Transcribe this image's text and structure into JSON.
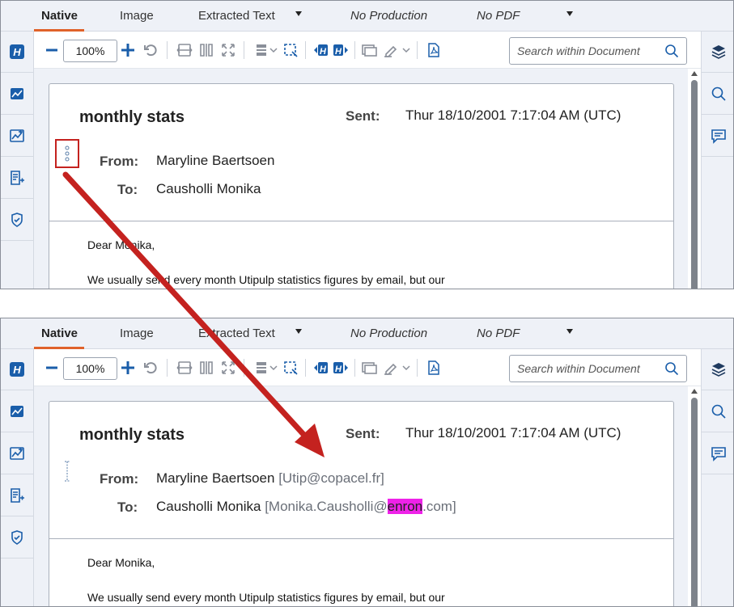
{
  "tabs": {
    "native": "Native",
    "image": "Image",
    "extracted_text": "Extracted Text",
    "no_production": "No Production",
    "no_pdf": "No PDF"
  },
  "toolbar": {
    "zoom_value": "100%",
    "search_placeholder": "Search within Document"
  },
  "document": {
    "subject": "monthly stats",
    "sent_label": "Sent:",
    "sent_value": "Thur 18/10/2001 7:17:04 AM (UTC)",
    "from_label": "From:",
    "from_name": "Maryline Baertsoen",
    "from_address": "[Utip@copacel.fr]",
    "to_label": "To:",
    "to_name": "Causholli  Monika",
    "to_address_prefix": "[Monika.Causholli@",
    "to_address_highlight": "enron",
    "to_address_suffix": ".com]",
    "greeting": "Dear Monika,",
    "body_line_1": "We usually send every month Utipulp statistics figures by email, but our"
  },
  "icons": {
    "left_sidebar": [
      "relativity-h-icon",
      "image-viewer-icon",
      "image-edit-icon",
      "coding-layout-icon",
      "secure-shield-icon"
    ],
    "right_sidebar": [
      "layers-icon",
      "search-icon",
      "comment-icon"
    ],
    "annotation_color": "#c4221f",
    "highlight_color": "#ee22e8",
    "accent_color": "#e0622a",
    "icon_blue": "#1a5eaa"
  }
}
